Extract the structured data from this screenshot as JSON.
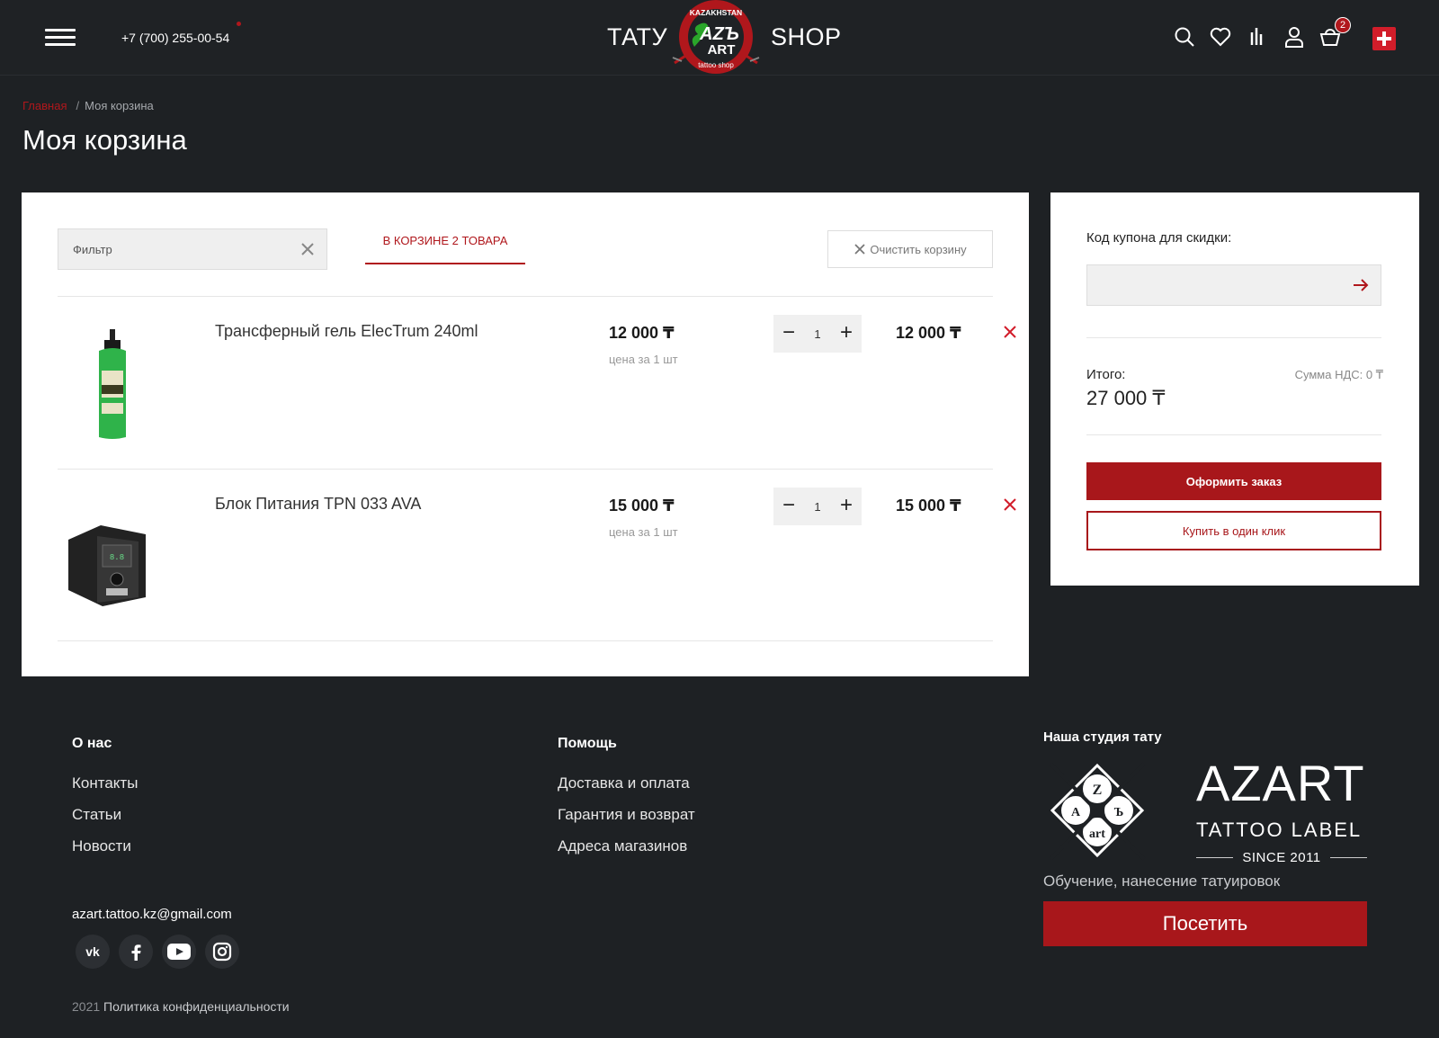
{
  "header": {
    "phone": "+7 (700) 255-00-54",
    "brand_left": "ТАТУ",
    "brand_right": "SHOP",
    "logo_text": {
      "top": "KAZAKHSTAN",
      "main_1": "AZЪ",
      "main_2": "ART",
      "bottom": "tattoo shop"
    },
    "cart_count": "2",
    "icons": [
      "search-icon",
      "heart-icon",
      "compare-icon",
      "user-icon",
      "basket-icon",
      "swiss-flag-icon"
    ],
    "accent_color": "#b0171c"
  },
  "breadcrumb": {
    "home": "Главная",
    "separator": "/",
    "current": "Моя корзина"
  },
  "page_title": "Моя корзина",
  "cart": {
    "filter_placeholder": "Фильтр",
    "tab_label": "В КОРЗИНЕ 2 ТОВАРА",
    "clear_label": "Очистить корзину",
    "items": [
      {
        "name": "Трансферный гель ElecTrum 240ml",
        "price": "12 000 ₸",
        "unit_label": "цена за 1 шт",
        "qty": "1",
        "total": "12 000 ₸",
        "image": "green-gel-bottle"
      },
      {
        "name": "Блок Питания TPN 033 AVA",
        "price": "15 000 ₸",
        "unit_label": "цена за 1 шт",
        "qty": "1",
        "total": "15 000 ₸",
        "image": "power-supply-unit"
      }
    ]
  },
  "summary": {
    "coupon_label": "Код купона для скидки:",
    "total_label": "Итого:",
    "vat_label": "Сумма НДС: 0 ₸",
    "total_value": "27 000 ₸",
    "order_button": "Оформить заказ",
    "one_click_button": "Купить в один клик"
  },
  "footer": {
    "about": {
      "heading": "О нас",
      "links": [
        "Контакты",
        "Статьи",
        "Новости"
      ]
    },
    "help": {
      "heading": "Помощь",
      "links": [
        "Доставка и оплата",
        "Гарантия и возврат",
        "Адреса магазинов"
      ]
    },
    "email": "azart.tattoo.kz@gmail.com",
    "socials": [
      "vk-icon",
      "facebook-icon",
      "youtube-icon",
      "instagram-icon"
    ],
    "copyright_year": "2021",
    "privacy": "Политика конфиденциальности",
    "studio": {
      "heading": "Наша студия тату",
      "title": "AZART",
      "subtitle": "TATTOO LABEL",
      "since": "SINCE 2011",
      "description": "Обучение, нанесение татуировок",
      "visit_button": "Посетить"
    }
  }
}
